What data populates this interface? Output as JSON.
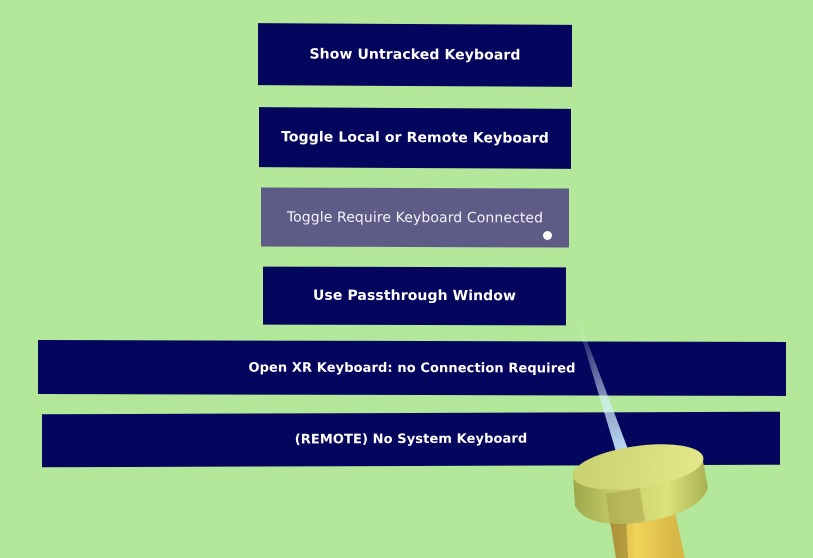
{
  "menu": {
    "buttons": [
      {
        "label": "Show Untracked Keyboard"
      },
      {
        "label": "Toggle Local or Remote Keyboard"
      },
      {
        "label": "Toggle Require Keyboard Connected"
      },
      {
        "label": "Use Passthrough Window"
      },
      {
        "label": "Open XR Keyboard: no Connection Required"
      },
      {
        "label": "(REMOTE) No System Keyboard"
      }
    ]
  },
  "colors": {
    "background": "#b3e89b",
    "button": "#04055c",
    "button_hovered": "#5e5b86",
    "text": "#ffffff",
    "controller": "#d9e070"
  },
  "icons": {
    "cursor": "pointer-cursor-dot",
    "controller": "vr-controller"
  }
}
